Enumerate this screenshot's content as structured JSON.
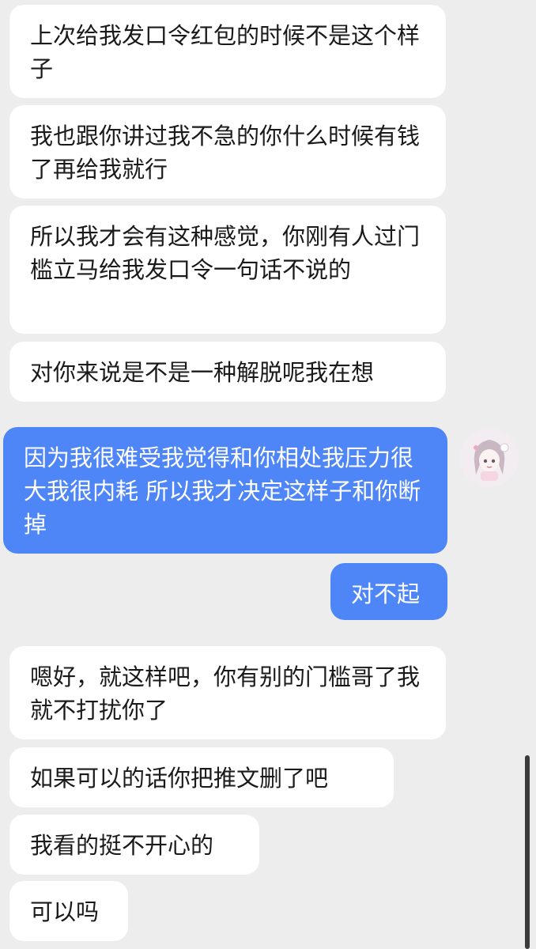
{
  "messages": [
    {
      "side": "in",
      "text": "上次给我发口令红包的时候不是这个样子"
    },
    {
      "side": "in",
      "text": "我也跟你讲过我不急的你什么时候有钱了再给我就行"
    },
    {
      "side": "in",
      "text": "所以我才会有这种感觉，你刚有人过门槛立马给我发口令一句话不说的"
    },
    {
      "side": "in",
      "text": "对你来说是不是一种解脱呢我在想"
    },
    {
      "side": "out",
      "text": "因为我很难受我觉得和你相处我压力很大我很内耗 所以我才决定这样子和你断掉"
    },
    {
      "side": "out",
      "text": "对不起"
    },
    {
      "side": "in",
      "text": "嗯好，就这样吧，你有别的门槛哥了我就不打扰你了"
    },
    {
      "side": "in",
      "text": "如果可以的话你把推文删了吧"
    },
    {
      "side": "in",
      "text": "我看的挺不开心的"
    },
    {
      "side": "in",
      "text": "可以吗"
    }
  ],
  "colors": {
    "background": "#ededed",
    "incoming_bubble": "#ffffff",
    "outgoing_bubble": "#4f86f7",
    "outgoing_text": "#ffffff"
  },
  "avatar": {
    "icon": "anime-girl-avatar-icon"
  }
}
